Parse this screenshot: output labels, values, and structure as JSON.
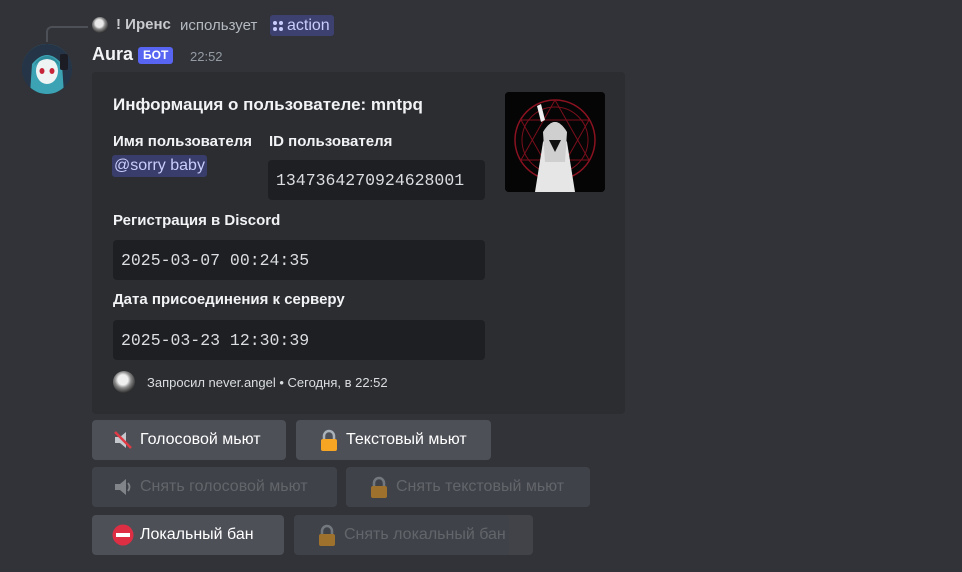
{
  "reply": {
    "username": "! Иренс",
    "verb": "использует",
    "command": "action"
  },
  "message": {
    "author": "Aura",
    "badge": "БОТ",
    "time": "22:52"
  },
  "embed": {
    "title": "Информация о пользователе: mntpq",
    "fields": {
      "username_label": "Имя пользователя",
      "username_value": "@sorry baby",
      "id_label": "ID пользователя",
      "id_value": "1347364270924628001",
      "registered_label": "Регистрация в Discord",
      "registered_value": "2025-03-07 00:24:35",
      "joined_label": "Дата присоединения к серверу",
      "joined_value": "2025-03-23 12:30:39"
    },
    "footer": "Запросил never.angel • Сегодня, в 22:52"
  },
  "buttons": {
    "voice_mute": "Голосовой мьют",
    "text_mute": "Текстовый мьют",
    "unvoice_mute": "Снять голосовой мьют",
    "untext_mute": "Снять текстовый мьют",
    "local_ban": "Локальный бан",
    "unlocal_ban": "Снять локальный бан"
  },
  "icons": {
    "voice_mute": "muted-speaker-icon",
    "text_mute": "lock-icon",
    "unvoice_mute": "speaker-icon",
    "untext_mute": "lock-icon",
    "local_ban": "no-entry-icon",
    "unlocal_ban": "lock-icon",
    "command": "app-command-icon"
  },
  "colors": {
    "background": "#313338",
    "embed": "#2b2d31",
    "codebox": "#1e1f22",
    "button": "#4e5058",
    "bot_badge": "#5865f2",
    "mention": "#c9cdfb"
  }
}
